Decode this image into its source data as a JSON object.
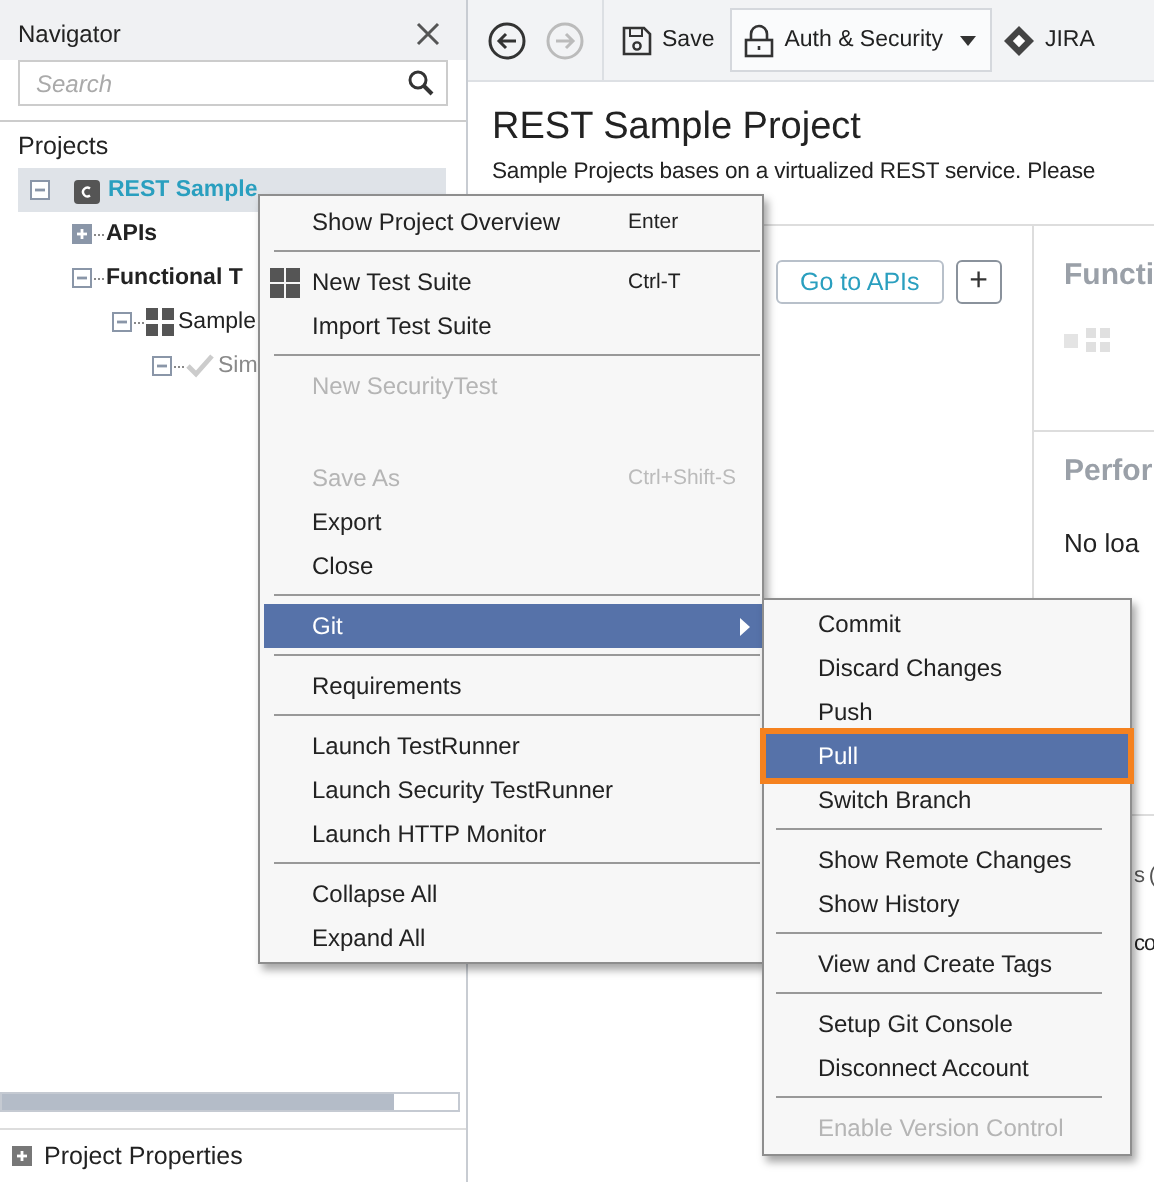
{
  "navigator": {
    "title": "Navigator",
    "search": {
      "placeholder": "Search"
    },
    "section": "Projects",
    "tree": [
      {
        "label": "REST Sample",
        "kind": "project",
        "selected": true,
        "expanded": true,
        "children": [
          {
            "label": "APIs",
            "kind": "folder",
            "selected": false,
            "expanded": false
          },
          {
            "label": "Functional T",
            "kind": "folder",
            "selected": false,
            "expanded": true,
            "children": [
              {
                "label": "Sample",
                "kind": "suite",
                "selected": false,
                "expanded": true,
                "children": [
                  {
                    "label": "Sim",
                    "kind": "case",
                    "selected": false,
                    "expanded": true
                  }
                ]
              }
            ]
          }
        ]
      }
    ],
    "footer": {
      "label": "Project Properties",
      "expanded": false
    }
  },
  "toolbar": [
    {
      "kind": "back",
      "disabled": false
    },
    {
      "kind": "forward",
      "disabled": true
    },
    {
      "kind": "save",
      "label": "Save"
    },
    {
      "kind": "dropdown",
      "label": "Auth & Security"
    },
    {
      "kind": "jira",
      "label": "JIRA"
    }
  ],
  "page": {
    "title": "REST Sample Project",
    "description": "Sample Projects bases on a virtualized REST service. Please",
    "buttons": [
      {
        "kind": "text",
        "label": "Go to APIs"
      },
      {
        "kind": "icon",
        "label": "+"
      }
    ],
    "panel_1": {
      "title": "Functi"
    },
    "panel_2": {
      "title": "Perfor",
      "text": "No loa"
    },
    "panel_3": {
      "title": "s (",
      "text": "co"
    }
  },
  "context_menu": {
    "upper": [
      {
        "kind": "item",
        "label": "Show Project Overview",
        "shortcut": "Enter",
        "disabled": false,
        "selected": false
      },
      {
        "kind": "separator"
      },
      {
        "kind": "icon_item",
        "label": "New Test Suite",
        "shortcut": "Ctrl-T",
        "disabled": false,
        "selected": false
      },
      {
        "kind": "item",
        "label": "Import Test Suite",
        "disabled": false,
        "selected": false
      },
      {
        "kind": "separator"
      },
      {
        "kind": "item",
        "label": "New SecurityTest",
        "disabled": true,
        "selected": false
      }
    ],
    "lower": [
      {
        "kind": "item",
        "label": "Save As",
        "shortcut": "Ctrl+Shift-S",
        "disabled": true,
        "selected": false
      },
      {
        "kind": "item",
        "label": "Export",
        "disabled": false,
        "selected": false
      },
      {
        "kind": "item",
        "label": "Close",
        "disabled": false,
        "selected": false
      },
      {
        "kind": "separator"
      },
      {
        "kind": "submenu",
        "label": "Git",
        "disabled": false,
        "selected": true
      },
      {
        "kind": "separator"
      },
      {
        "kind": "item",
        "label": "Requirements",
        "disabled": false,
        "selected": false
      },
      {
        "kind": "separator"
      },
      {
        "kind": "item",
        "label": "Launch TestRunner",
        "disabled": false,
        "selected": false
      },
      {
        "kind": "item",
        "label": "Launch Security TestRunner",
        "disabled": false,
        "selected": false
      },
      {
        "kind": "item",
        "label": "Launch HTTP Monitor",
        "disabled": false,
        "selected": false
      },
      {
        "kind": "separator"
      },
      {
        "kind": "item",
        "label": "Collapse All",
        "disabled": false,
        "selected": false
      },
      {
        "kind": "item",
        "label": "Expand All",
        "disabled": false,
        "selected": false
      }
    ]
  },
  "git_menu": [
    {
      "kind": "item",
      "label": "Commit",
      "disabled": false,
      "selected": false
    },
    {
      "kind": "item",
      "label": "Discard Changes",
      "disabled": false,
      "selected": false
    },
    {
      "kind": "item",
      "label": "Push",
      "disabled": false,
      "selected": false
    },
    {
      "kind": "item",
      "label": "Pull",
      "disabled": false,
      "selected": true
    },
    {
      "kind": "item",
      "label": "Switch Branch",
      "disabled": false,
      "selected": false
    },
    {
      "kind": "separator"
    },
    {
      "kind": "item",
      "label": "Show Remote Changes",
      "disabled": false,
      "selected": false
    },
    {
      "kind": "item",
      "label": "Show History",
      "disabled": false,
      "selected": false
    },
    {
      "kind": "separator"
    },
    {
      "kind": "item",
      "label": "View and Create Tags",
      "disabled": false,
      "selected": false
    },
    {
      "kind": "separator"
    },
    {
      "kind": "item",
      "label": "Setup Git Console",
      "disabled": false,
      "selected": false
    },
    {
      "kind": "item",
      "label": "Disconnect Account",
      "disabled": false,
      "selected": false
    },
    {
      "kind": "separator"
    },
    {
      "kind": "item",
      "label": "Enable Version Control",
      "disabled": true,
      "selected": false
    }
  ]
}
